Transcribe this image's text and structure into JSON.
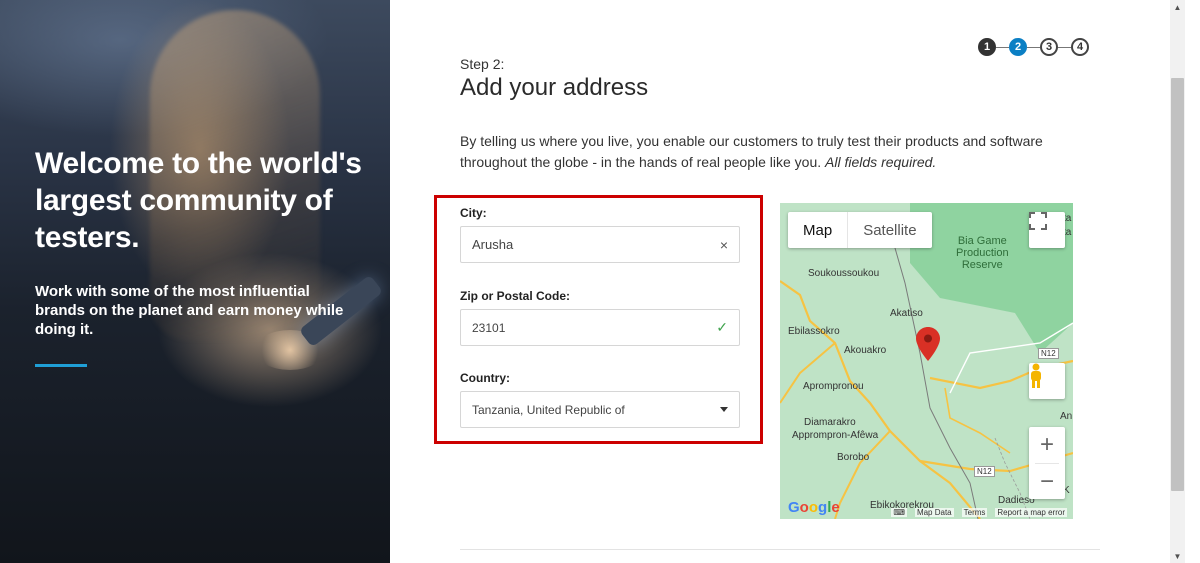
{
  "hero": {
    "title": "Welcome to the world's largest community of testers.",
    "subtitle": "Work with some of the most influential brands on the planet and earn money while doing it."
  },
  "stepper": {
    "steps": [
      "1",
      "2",
      "3",
      "4"
    ],
    "active_step": 2
  },
  "main": {
    "step_label": "Step 2:",
    "title": "Add your address",
    "intro": "By telling us where you live, you enable our customers to truly test their products and software throughout the globe - in the hands of real people like you.",
    "intro_emphasis": "All fields required."
  },
  "form": {
    "city_label": "City:",
    "city_value": "Arusha",
    "city_clear_icon": "×",
    "zip_label": "Zip or Postal Code:",
    "zip_value": "23101",
    "zip_valid_icon": "✓",
    "country_label": "Country:",
    "country_value": "Tanzania, United Republic of"
  },
  "map": {
    "tab_map": "Map",
    "tab_satellite": "Satellite",
    "labels": {
      "park": "Bia Game\nProduction\nReserve",
      "soukoussoukou": "Soukoussoukou",
      "akatiso": "Akatiso",
      "ebilassokro": "Ebilassokro",
      "akouakro": "Akouakro",
      "n12_a": "N12",
      "n12_b": "N12",
      "aprompronou": "Aprompronou",
      "diamarakro": "Diamarakro",
      "apprompron": "Apprompron-Afêwa",
      "borobo": "Borobo",
      "ebikokorekrou": "Ebikokorekrou",
      "dadieso": "Dadieso",
      "edge_ta1": "ta",
      "edge_ta2": "ta",
      "edge_an": "An",
      "edge_k": "K"
    },
    "google": "Google",
    "footer": [
      "Map Data",
      "Terms",
      "Report a map error"
    ],
    "fullscreen_icon": "fullscreen-icon",
    "pegman_icon": "pegman-icon",
    "zoom_in": "+",
    "zoom_out": "−",
    "road_color": "#f6c343",
    "park_color": "#8fd3a0",
    "pin_color": "#d93025"
  },
  "colors": {
    "accent": "#0b7fc4",
    "highlight_box": "#cc0000",
    "hero_rule": "#1f9fd6"
  }
}
